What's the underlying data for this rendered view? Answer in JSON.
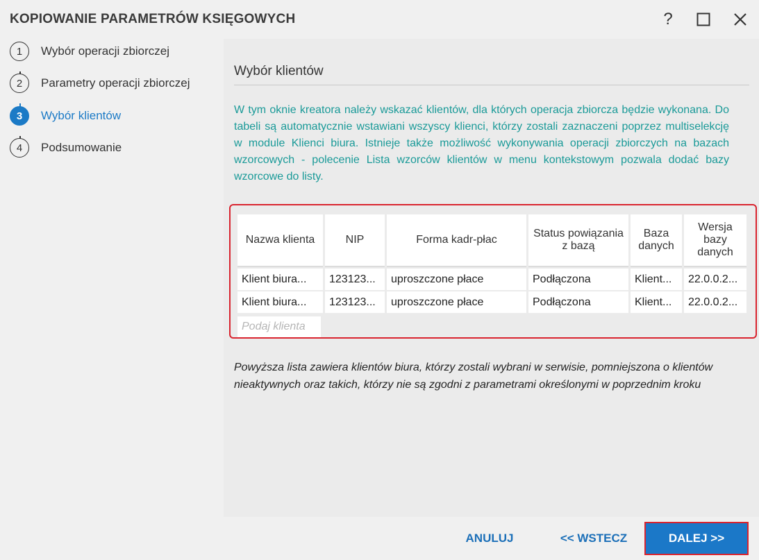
{
  "window": {
    "title": "KOPIOWANIE PARAMETRÓW KSIĘGOWYCH",
    "help_label": "?"
  },
  "steps": [
    {
      "num": "1",
      "label": "Wybór operacji zbiorczej",
      "active": false
    },
    {
      "num": "2",
      "label": "Parametry operacji zbiorczej",
      "active": false
    },
    {
      "num": "3",
      "label": "Wybór klientów",
      "active": true
    },
    {
      "num": "4",
      "label": "Podsumowanie",
      "active": false
    }
  ],
  "main": {
    "section_title": "Wybór klientów",
    "description": "W tym oknie kreatora należy wskazać klientów, dla których operacja zbiorcza będzie wykonana. Do tabeli są automatycznie wstawiani wszyscy klienci, którzy zostali zaznaczeni poprzez multiselekcję w module Klienci biura. Istnieje także możliwość wykonywania operacji zbiorczych na bazach wzorcowych - polecenie Lista wzorców klientów w menu kontekstowym pozwala dodać bazy wzorcowe do listy.",
    "table": {
      "columns": [
        "Nazwa klienta",
        "NIP",
        "Forma kadr-płac",
        "Status powiązania z bazą",
        "Baza danych",
        "Wersja bazy danych"
      ],
      "rows": [
        [
          "Klient biura...",
          "123123...",
          "uproszczone płace",
          "Podłączona",
          "Klient...",
          "22.0.0.2..."
        ],
        [
          "Klient biura...",
          "123123...",
          "uproszczone płace",
          "Podłączona",
          "Klient...",
          "22.0.0.2..."
        ]
      ],
      "search_placeholder": "Podaj klienta"
    },
    "note": "Powyższa lista zawiera klientów biura, którzy zostali wybrani w serwisie, pomniejszona o klientów nieaktywnych oraz takich, którzy nie są zgodni z parametrami określonymi w poprzednim kroku"
  },
  "footer": {
    "cancel_label": "ANULUJ",
    "back_label": "<< WSTECZ",
    "next_label": "DALEJ >>"
  },
  "colors": {
    "accent": "#1b7ac6",
    "description_text": "#1a9a98",
    "highlight_border": "#d9232e"
  }
}
